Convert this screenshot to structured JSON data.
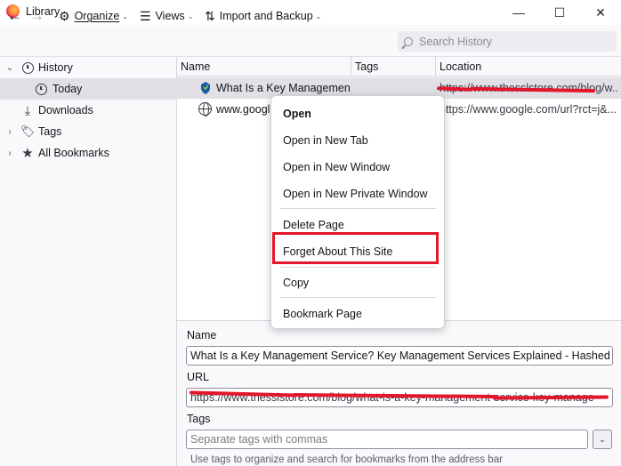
{
  "window": {
    "title": "Library",
    "controls": {
      "minimize": "—",
      "maximize": "☐",
      "close": "✕"
    }
  },
  "toolbar": {
    "back_icon": "←",
    "forward_icon": "→",
    "organize_label": "Organize",
    "views_label": "Views",
    "import_backup_label": "Import and Backup",
    "search_placeholder": "Search History"
  },
  "sidebar": {
    "items": [
      {
        "label": "History",
        "icon": "clock-icon",
        "expanded": true
      },
      {
        "label": "Today",
        "icon": "clock-icon",
        "selected": true
      },
      {
        "label": "Downloads",
        "icon": "download-icon"
      },
      {
        "label": "Tags",
        "icon": "tag-icon",
        "expanded": false
      },
      {
        "label": "All Bookmarks",
        "icon": "star-icon",
        "expanded": false
      }
    ]
  },
  "list": {
    "columns": [
      "Name",
      "Tags",
      "Location"
    ],
    "rows": [
      {
        "name": "What Is a Key Managemen...",
        "tags": "",
        "location": "https://www.thesslstore.com/blog/w..."
      },
      {
        "name": "www.googl",
        "tags": "",
        "location": "https://www.google.com/url?rct=j&..."
      }
    ]
  },
  "context_menu": {
    "items": [
      {
        "label": "Open",
        "bold": true
      },
      {
        "label": "Open in New Tab"
      },
      {
        "label": "Open in New Window"
      },
      {
        "label": "Open in New Private Window"
      },
      {
        "label": "Delete Page"
      },
      {
        "label": "Forget About This Site",
        "highlighted": true
      },
      {
        "label": "Copy"
      },
      {
        "label": "Bookmark Page"
      }
    ],
    "highlight_color": "#e3162b"
  },
  "details": {
    "name_label": "Name",
    "name_value": "What Is a Key Management Service? Key Management Services Explained - Hashed Out by",
    "url_label": "URL",
    "url_value": "https://www.thesslstore.com/blog/what-is-a-key-management-service-key-manage",
    "tags_label": "Tags",
    "tags_placeholder": "Separate tags with commas",
    "hint": "Use tags to organize and search for bookmarks from the address bar"
  }
}
